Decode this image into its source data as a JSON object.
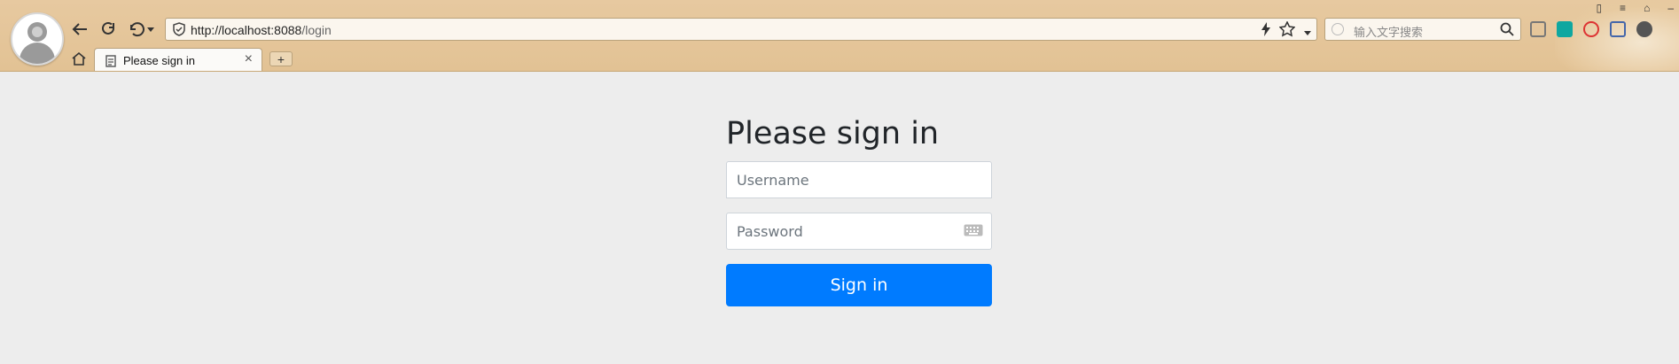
{
  "browser": {
    "url_host": "http://localhost:8088",
    "url_path": "/login",
    "search_placeholder": "输入文字搜索",
    "tab_title": "Please sign in",
    "tab_close": "×",
    "new_tab": "+",
    "icons": [
      "back-icon",
      "refresh-icon",
      "undo-icon",
      "shield-icon",
      "lightning-icon",
      "star-icon",
      "chevron-down-icon",
      "search-icon",
      "home-icon",
      "document-icon",
      "keyboard-icon"
    ]
  },
  "login": {
    "heading": "Please sign in",
    "username_placeholder": "Username",
    "password_placeholder": "Password",
    "submit_label": "Sign in"
  },
  "colors": {
    "chrome": "#e2c294",
    "primary": "#007bff",
    "page_bg": "#ededed"
  }
}
